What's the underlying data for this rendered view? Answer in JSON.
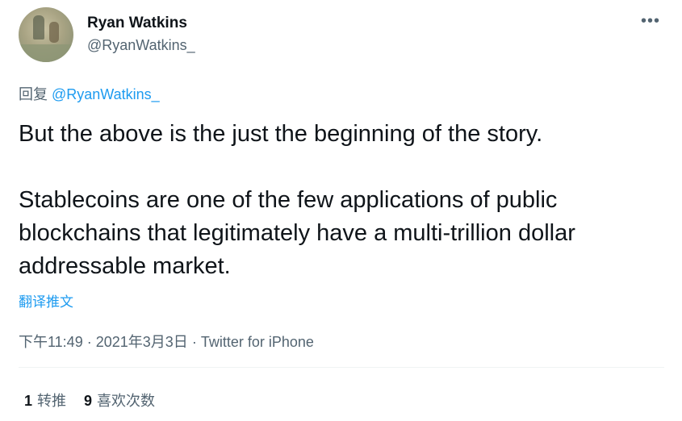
{
  "author": {
    "display_name": "Ryan Watkins",
    "handle": "@RyanWatkins_"
  },
  "more_label": "•••",
  "reply": {
    "prefix": "回复",
    "mention": "@RyanWatkins_"
  },
  "tweet": {
    "paragraphs": [
      "But the above is the just the beginning of the story.",
      "Stablecoins are one of the few applications of public blockchains that legitimately have a multi-trillion dollar addressable market."
    ],
    "translate_label": "翻译推文"
  },
  "meta": {
    "time": "下午11:49",
    "date": "2021年3月3日",
    "source": "Twitter for iPhone"
  },
  "stats": {
    "retweets_count": "1",
    "retweets_label": "转推",
    "likes_count": "9",
    "likes_label": "喜欢次数"
  },
  "colors": {
    "accent": "#1d9bf0",
    "secondary_text": "#536471",
    "primary_text": "#0f1419"
  }
}
